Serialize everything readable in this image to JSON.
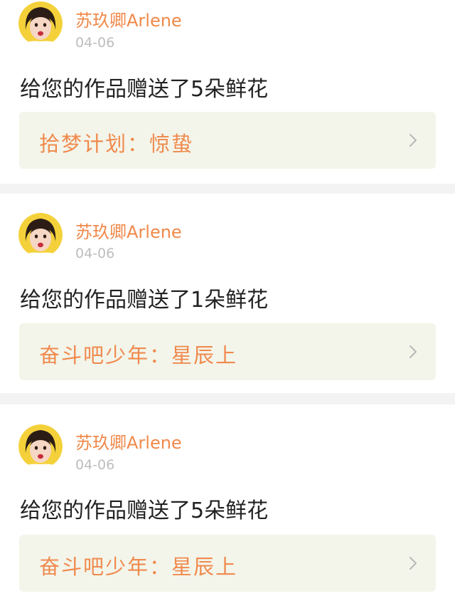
{
  "notifications": [
    {
      "user": "苏玖卿Arlene",
      "date": "04-06",
      "message": "给您的作品赠送了5朵鲜花",
      "work_title": "拾梦计划：惊蛰"
    },
    {
      "user": "苏玖卿Arlene",
      "date": "04-06",
      "message": "给您的作品赠送了1朵鲜花",
      "work_title": "奋斗吧少年：星辰上"
    },
    {
      "user": "苏玖卿Arlene",
      "date": "04-06",
      "message": "给您的作品赠送了5朵鲜花",
      "work_title": "奋斗吧少年：星辰上"
    }
  ],
  "colors": {
    "accent": "#f0894a",
    "link_bg": "#f3f5ea",
    "divider": "#f3f3f3",
    "date": "#bdbdbd"
  },
  "icons": {
    "avatar": "user-avatar",
    "chevron": "chevron-right-icon"
  }
}
